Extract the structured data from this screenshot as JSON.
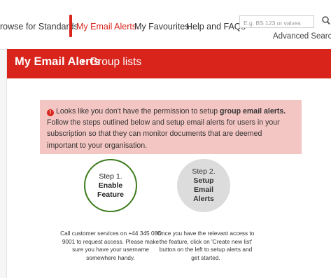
{
  "nav": {
    "items": [
      {
        "label": "rowse for Standards"
      },
      {
        "label": "My Email Alerts"
      },
      {
        "label": "My Favourites"
      },
      {
        "label": "Help and FAQs"
      }
    ],
    "search_placeholder": "E.g. BS 123 or valves",
    "advanced_search_label": "Advanced Search"
  },
  "header": {
    "title": "My Email Alerts",
    "separator": "▸",
    "subtitle": "Group lists"
  },
  "alert": {
    "icon": "exclamation-icon",
    "text_before": "Looks like you don't have the permission to setup ",
    "text_bold": "group email alerts.",
    "text_after": " Follow the steps outlined below and setup email alerts for users in your subscription so that they can monitor documents that are deemed important to your organisation."
  },
  "steps": [
    {
      "number": "Step 1.",
      "title": "Enable Feature",
      "description": "Call customer services on +44 345 086 9001 to request access. Please make sure you have your username somewhere handy."
    },
    {
      "number": "Step 2.",
      "title": "Setup Email Alerts",
      "description": "Once you have the relevant access to the feature, click on 'Create new list' button on the left to setup alerts and get started."
    }
  ],
  "colors": {
    "brand_red": "#d9241c",
    "alert_bg": "#f4c6c3",
    "step1_border": "#3d7c1c",
    "step2_bg": "#dcdcdc"
  }
}
